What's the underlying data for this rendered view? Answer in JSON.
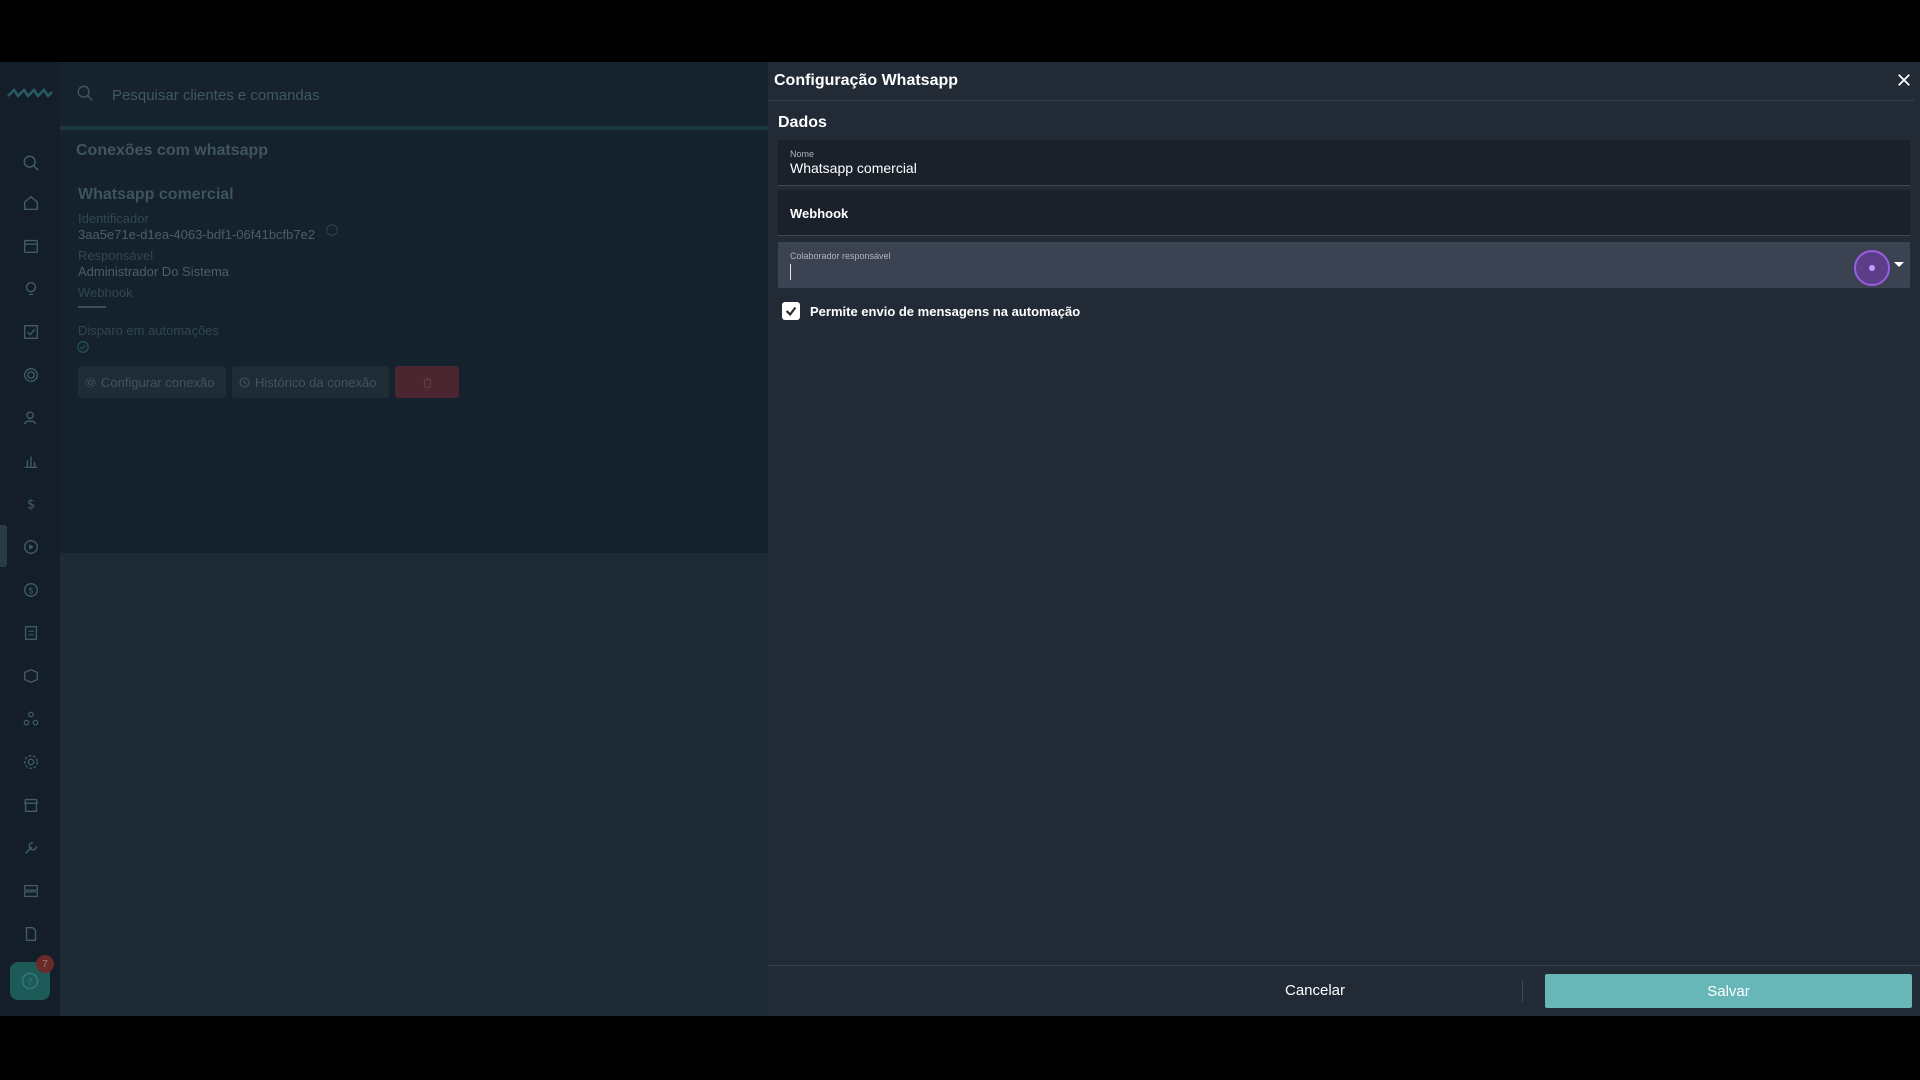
{
  "search": {
    "placeholder": "Pesquisar clientes e comandas"
  },
  "background_page": {
    "card_title": "Conexões com whatsapp",
    "connection": {
      "name": "Whatsapp comercial",
      "identifier_label": "Identificador",
      "identifier_value": "3aa5e71e-d1ea-4063-bdf1-06f41bcfb7e2",
      "responsible_label": "Responsável",
      "responsible_value": "Administrador Do Sistema",
      "webhook_label": "Webhook",
      "automation_label": "Disparo em automações"
    },
    "buttons": {
      "configure": "Configurar conexão",
      "history": "Histórico da conexão"
    }
  },
  "sidebar": {
    "help_badge_count": "7",
    "icons": [
      "search-icon",
      "home-icon",
      "calendar-icon",
      "lightbulb-icon",
      "checklist-icon",
      "target-icon",
      "user-icon",
      "chart-icon",
      "dollar-icon",
      "whatsapp-icon",
      "coin-icon",
      "document-icon",
      "box-icon",
      "network-icon",
      "gear-icon",
      "store-icon",
      "wrench-icon",
      "server-icon",
      "file-icon",
      "help-icon"
    ]
  },
  "drawer": {
    "title": "Configuração Whatsapp",
    "section_title": "Dados",
    "fields": {
      "name_label": "Nome",
      "name_value": "Whatsapp comercial",
      "webhook_label": "Webhook",
      "collaborator_label": "Colaborador responsável",
      "collaborator_value": ""
    },
    "checkbox": {
      "label": "Permite envio de mensagens na automação",
      "checked": true
    },
    "footer": {
      "cancel_label": "Cancelar",
      "save_label": "Salvar"
    }
  },
  "colors": {
    "accent": "#67b7b8",
    "drawer_bg": "#222a36",
    "field_bg": "#1a212b",
    "field_active_bg": "#3b4252",
    "cursor_ring": "#9b5de5"
  }
}
